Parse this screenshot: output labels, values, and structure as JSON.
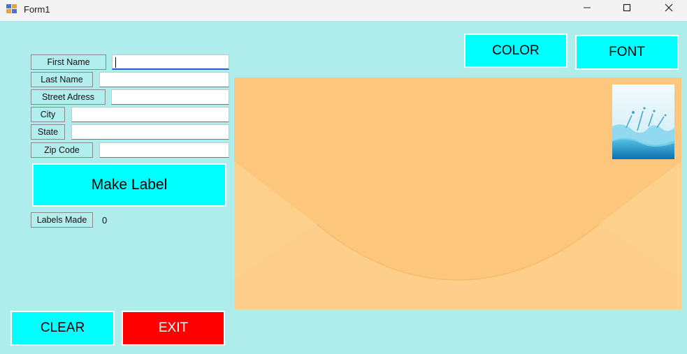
{
  "window": {
    "title": "Form1",
    "minimize_icon": "minimize-icon",
    "maximize_icon": "maximize-icon",
    "close_icon": "close-icon"
  },
  "form": {
    "first_name_label": "First Name",
    "first_name_value": "",
    "last_name_label": "Last Name",
    "last_name_value": "",
    "street_label": "Street Adress",
    "street_value": "",
    "city_label": "City",
    "city_value": "",
    "state_label": "State",
    "state_value": "",
    "zip_label": "Zip Code",
    "zip_value": ""
  },
  "buttons": {
    "make_label": "Make Label",
    "color": "COLOR",
    "font": "FONT",
    "clear": "CLEAR",
    "exit": "EXIT"
  },
  "counter": {
    "label": "Labels Made",
    "value": "0"
  },
  "colors": {
    "background": "#afecec",
    "button_cyan": "#00ffff",
    "button_exit": "#ff0000",
    "envelope": "#fcc67c"
  }
}
